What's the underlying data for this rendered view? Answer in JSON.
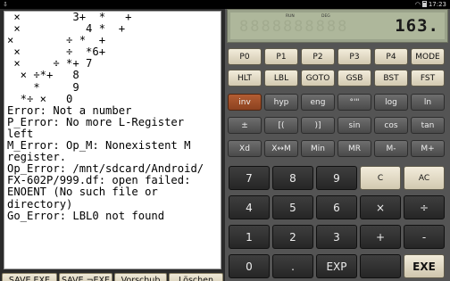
{
  "statusbar": {
    "left_icon": "⇩",
    "time": "17:23"
  },
  "printer": {
    "lines": [
      " ×        3+  *   +",
      " ×          4 *  +",
      "×        ÷ *  +",
      " ×       ÷  *6+",
      " ×     ÷ *+ 7",
      "  × ÷*+   8",
      "    *     9",
      "  *÷ ×   0",
      "Error: Not a number",
      "P_Error: No more L-Register",
      "left",
      "M_Error: Op_M: Nonexistent M",
      "register.",
      "Op_Error: /mnt/sdcard/Android/",
      "FX-602P/999.df: open failed:",
      "ENOENT (No such file or",
      "directory)",
      "Go_Error: LBL0 not found"
    ]
  },
  "bottom_buttons": [
    "SAVE EXE",
    "SAVE ¬EXE",
    "Vorschub",
    "Löschen"
  ],
  "display": {
    "value": "163.",
    "flag_run": "RUN",
    "flag_deg": "DEG",
    "ghost": "8888888888"
  },
  "keys": {
    "row1": [
      "P0",
      "P1",
      "P2",
      "P3",
      "P4",
      "MODE"
    ],
    "row2": [
      "HLT",
      "LBL",
      "GOTO",
      "GSB",
      "BST",
      "FST"
    ],
    "row3": [
      "inv",
      "hyp",
      "eng",
      "°'\"",
      "log",
      "ln"
    ],
    "row4": [
      "±",
      "[(",
      ")]",
      "sin",
      "cos",
      "tan"
    ],
    "row5": [
      "Xd",
      "X↔M",
      "Min",
      "MR",
      "M-",
      "M+"
    ],
    "num1": [
      "7",
      "8",
      "9",
      "C",
      "AC"
    ],
    "num2": [
      "4",
      "5",
      "6",
      "×",
      "÷"
    ],
    "num3": [
      "1",
      "2",
      "3",
      "+",
      "-"
    ],
    "num4": [
      "0",
      ".",
      "EXP",
      "",
      "EXE"
    ]
  }
}
